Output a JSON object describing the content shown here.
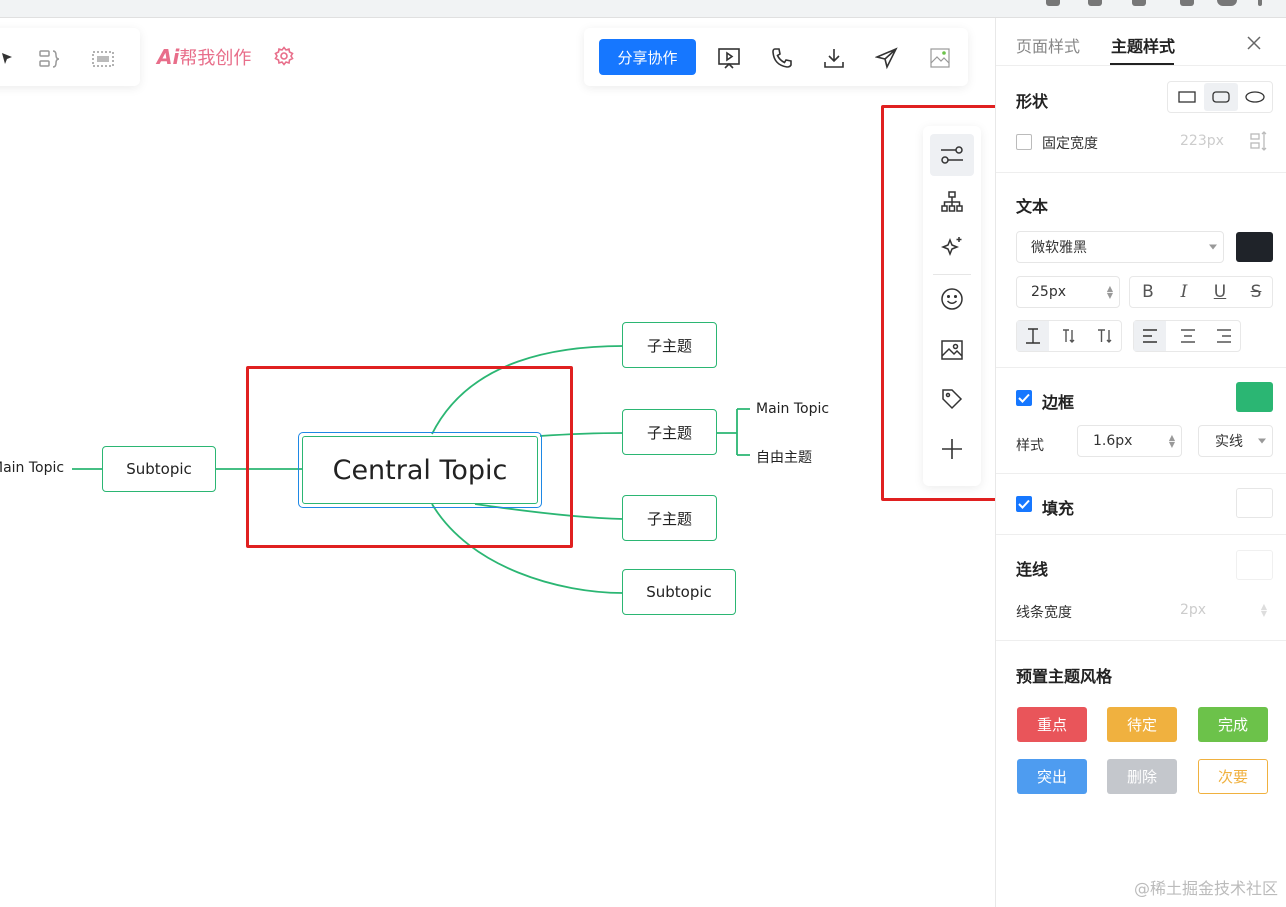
{
  "toolbar": {
    "ai_prefix": "Ai",
    "ai_title": "帮我创作",
    "share_label": "分享协作"
  },
  "mindmap": {
    "central": "Central Topic",
    "left_subtopic": "Subtopic",
    "left_main_topic": "Main Topic",
    "right_children": [
      "子主题",
      "子主题",
      "子主题",
      "Subtopic"
    ],
    "grandchildren": [
      "Main Topic",
      "自由主题"
    ]
  },
  "panel": {
    "tabs": [
      "页面样式",
      "主题样式"
    ],
    "shape_title": "形状",
    "fixed_width_label": "固定宽度",
    "fixed_width_value": "223px",
    "text_title": "文本",
    "font_family": "微软雅黑",
    "font_size": "25px",
    "text_color": "#1f2329",
    "border_title": "边框",
    "border_color": "#2bb673",
    "style_label": "样式",
    "border_width": "1.6px",
    "border_style": "实线",
    "fill_title": "填充",
    "line_title": "连线",
    "line_width_label": "线条宽度",
    "line_width_value": "2px",
    "preset_title": "预置主题风格",
    "presets": [
      {
        "label": "重点",
        "color": "#e9555a"
      },
      {
        "label": "待定",
        "color": "#f0b13f"
      },
      {
        "label": "完成",
        "color": "#6cc24a"
      },
      {
        "label": "突出",
        "color": "#4e9cf0"
      },
      {
        "label": "删除",
        "color": "#c4c7cc"
      },
      {
        "label": "次要",
        "color": "#f0b13f"
      }
    ]
  },
  "watermark": "@稀土掘金技术社区"
}
